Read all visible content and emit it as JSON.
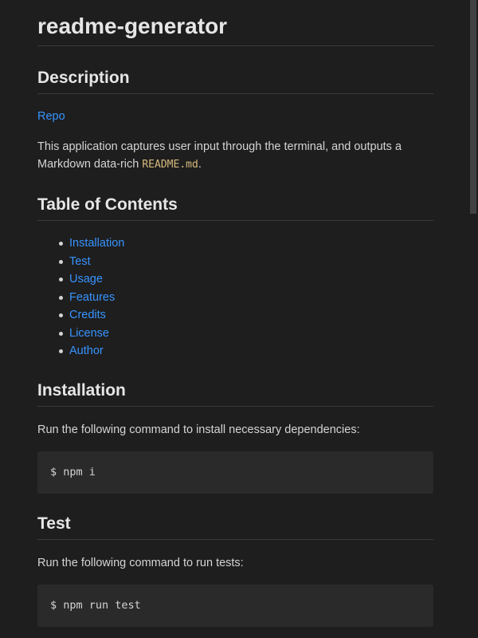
{
  "title": "readme-generator",
  "description": {
    "heading": "Description",
    "repo_link": "Repo",
    "text_before": "This application captures user input through the terminal, and outputs a Markdown data-rich ",
    "code": "README.md",
    "text_after": "."
  },
  "toc": {
    "heading": "Table of Contents",
    "items": [
      "Installation",
      "Test",
      "Usage",
      "Features",
      "Credits",
      "License",
      "Author"
    ]
  },
  "installation": {
    "heading": "Installation",
    "text": "Run the following command to install necessary dependencies:",
    "command": "$ npm i"
  },
  "test": {
    "heading": "Test",
    "text": "Run the following command to run tests:",
    "command": "$ npm run test"
  },
  "colors": {
    "background": "#1e1e1e",
    "link": "#3794ff",
    "code_block_bg": "#2a2a2a",
    "inline_code": "#d7ba7d"
  }
}
